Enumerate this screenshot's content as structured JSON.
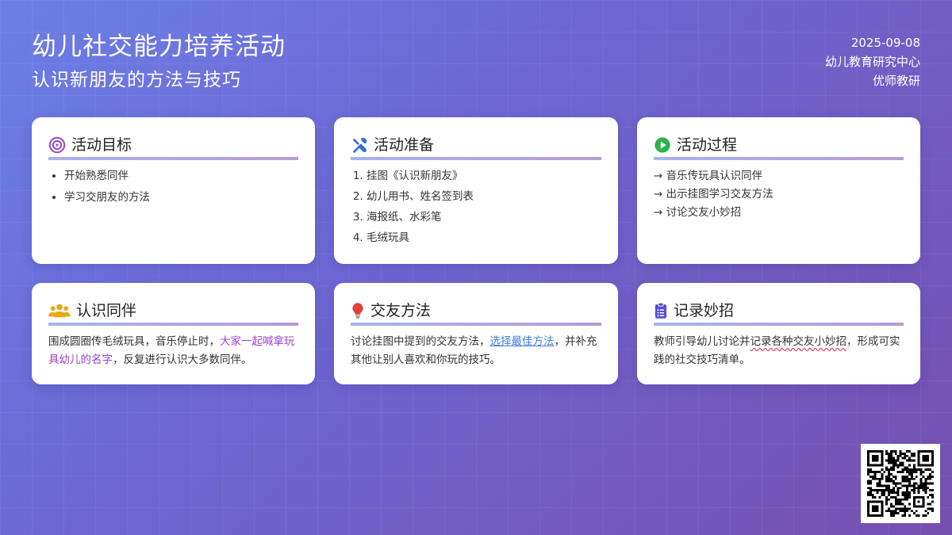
{
  "header": {
    "title": "幼儿社交能力培养活动",
    "subtitle": "认识新朋友的方法与技巧",
    "date": "2025-09-08",
    "org": "幼儿教育研究中心",
    "author": "优师教研"
  },
  "cards": {
    "goals": {
      "title": "活动目标",
      "icon": "target-icon",
      "items": [
        "开始熟悉同伴",
        "学习交朋友的方法"
      ]
    },
    "prep": {
      "title": "活动准备",
      "icon": "tools-icon",
      "items": [
        "挂图《认识新朋友》",
        "幼儿用书、姓名签到表",
        "海报纸、水彩笔",
        "毛绒玩具"
      ]
    },
    "process": {
      "title": "活动过程",
      "icon": "play-icon",
      "items": [
        "→ 音乐传玩具认识同伴",
        "→ 出示挂图学习交友方法",
        "→ 讨论交友小妙招"
      ]
    },
    "peers": {
      "title": "认识同伴",
      "icon": "users-icon",
      "text_before": "围成圆圈传毛绒玩具，音乐停止时，",
      "text_highlight": "大家一起喊拿玩具幼儿的名字",
      "text_after": "，反复进行认识大多数同伴。"
    },
    "methods": {
      "title": "交友方法",
      "icon": "lightbulb-icon",
      "text_before": "讨论挂图中提到的交友方法，",
      "text_highlight": "选择最佳方法",
      "text_after": "，并补充其他让别人喜欢和你玩的技巧。"
    },
    "record": {
      "title": "记录妙招",
      "icon": "clipboard-icon",
      "text_before": "教师引导幼儿讨论并",
      "text_highlight": "记录各种交友小妙招",
      "text_after": "，形成可实践的社交技巧清单。"
    }
  },
  "colors": {
    "bg_start": "#6a7fe6",
    "bg_end": "#7550b0",
    "highlight_purple": "#9b3fd1",
    "link_blue": "#3d7ed6",
    "icon_target": "#9b4fd6",
    "icon_tools": "#2f6fd6",
    "icon_play": "#2bb24c",
    "icon_users": "#e6a817",
    "icon_bulb": "#e0423a",
    "icon_clipboard": "#5a4fd6"
  }
}
